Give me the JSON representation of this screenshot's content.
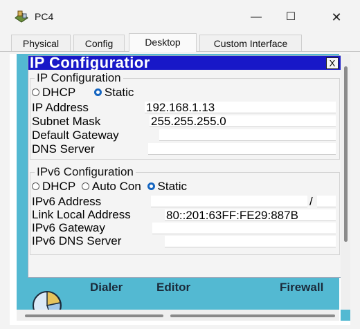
{
  "window": {
    "title": "PC4",
    "minimize": "—",
    "maximize": "☐",
    "close": "✕"
  },
  "tabs": [
    {
      "label": "Physical"
    },
    {
      "label": "Config"
    },
    {
      "label": "Desktop"
    },
    {
      "label": "Custom Interface"
    }
  ],
  "ip_window": {
    "title": "IP Configuratior",
    "close_label": "X",
    "ipv4": {
      "group_title": "IP Configuration",
      "dhcp_label": "DHCP",
      "static_label": "Static",
      "selected": "Static",
      "ip_address_label": "IP Address",
      "ip_address_value": "192.168.1.13",
      "subnet_mask_label": "Subnet Mask",
      "subnet_mask_value": "255.255.255.0",
      "gateway_label": "Default Gateway",
      "gateway_value": "",
      "dns_label": "DNS Server",
      "dns_value": ""
    },
    "ipv6": {
      "group_title": "IPv6 Configuration",
      "dhcp_label": "DHCP",
      "auto_label": "Auto Con",
      "static_label": "Static",
      "selected": "Static",
      "address_label": "IPv6 Address",
      "address_value": "",
      "prefix_separator": "/",
      "prefix_value": "",
      "link_local_label": "Link Local Address",
      "link_local_value": "80::201:63FF:FE29:887B",
      "gateway_label": "IPv6 Gateway",
      "gateway_value": "",
      "dns_label": "IPv6 DNS Server",
      "dns_value": ""
    }
  },
  "desktop_apps": [
    {
      "label": "Dialer"
    },
    {
      "label": "Editor"
    },
    {
      "label": "Firewall"
    }
  ]
}
